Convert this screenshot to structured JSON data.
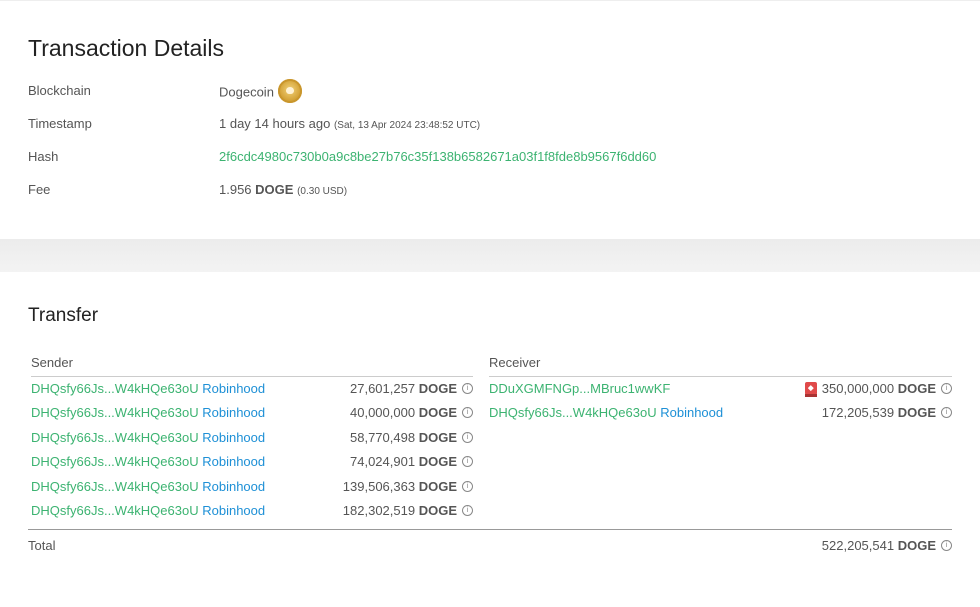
{
  "details": {
    "title": "Transaction Details",
    "rows": {
      "blockchain": {
        "label": "Blockchain",
        "value": "Dogecoin",
        "icon": "dogecoin-logo-icon"
      },
      "timestamp": {
        "label": "Timestamp",
        "value": "1 day 14 hours ago",
        "detail": "(Sat, 13 Apr 2024 23:48:52 UTC)"
      },
      "hash": {
        "label": "Hash",
        "value": "2f6cdc4980c730b0a9c8be27b76c35f138b6582671a03f1f8fde8b9567f6dd60"
      },
      "fee": {
        "label": "Fee",
        "amount": "1.956",
        "unit": "DOGE",
        "usd": "(0.30 USD)"
      }
    }
  },
  "transfer": {
    "title": "Transfer",
    "sender_header": "Sender",
    "receiver_header": "Receiver",
    "senders": [
      {
        "address": "DHQsfy66Js...W4kHQe63oU",
        "entity": "Robinhood",
        "amount": "27,601,257",
        "unit": "DOGE"
      },
      {
        "address": "DHQsfy66Js...W4kHQe63oU",
        "entity": "Robinhood",
        "amount": "40,000,000",
        "unit": "DOGE"
      },
      {
        "address": "DHQsfy66Js...W4kHQe63oU",
        "entity": "Robinhood",
        "amount": "58,770,498",
        "unit": "DOGE"
      },
      {
        "address": "DHQsfy66Js...W4kHQe63oU",
        "entity": "Robinhood",
        "amount": "74,024,901",
        "unit": "DOGE"
      },
      {
        "address": "DHQsfy66Js...W4kHQe63oU",
        "entity": "Robinhood",
        "amount": "139,506,363",
        "unit": "DOGE"
      },
      {
        "address": "DHQsfy66Js...W4kHQe63oU",
        "entity": "Robinhood",
        "amount": "182,302,519",
        "unit": "DOGE"
      }
    ],
    "receivers": [
      {
        "address": "DDuXGMFNGp...MBruc1wwKF",
        "entity": "",
        "amount": "350,000,000",
        "unit": "DOGE",
        "flag_icon": "alert-flag-icon"
      },
      {
        "address": "DHQsfy66Js...W4kHQe63oU",
        "entity": "Robinhood",
        "amount": "172,205,539",
        "unit": "DOGE"
      }
    ],
    "total_label": "Total",
    "total_amount": "522,205,541",
    "total_unit": "DOGE"
  },
  "colors": {
    "address_green": "#3cb371",
    "entity_blue": "#1e90d6",
    "flag_red": "#e04a4a"
  }
}
